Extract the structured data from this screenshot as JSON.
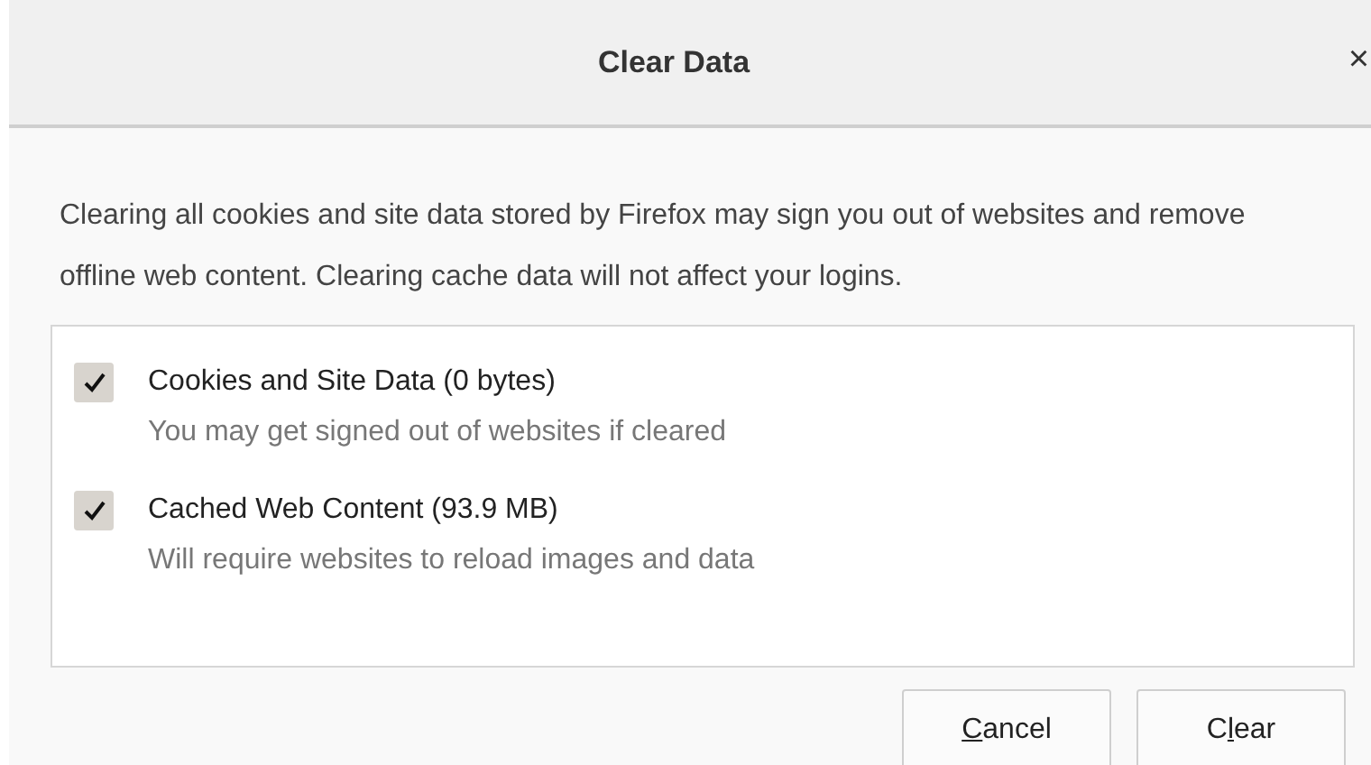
{
  "dialog": {
    "title": "Clear Data",
    "close": "×"
  },
  "description": "Clearing all cookies and site data stored by Firefox may sign you out of websites and remove offline web content. Clearing cache data will not affect your logins.",
  "options": [
    {
      "label": "Cookies and Site Data (0 bytes)",
      "note": "You may get signed out of websites if cleared",
      "checked": true
    },
    {
      "label": "Cached Web Content (93.9 MB)",
      "note": "Will require websites to reload images and data",
      "checked": true
    }
  ],
  "buttons": [
    {
      "accesskey": "C",
      "rest": "ancel"
    },
    {
      "before": "C",
      "accesskey": "l",
      "rest": "ear"
    }
  ]
}
